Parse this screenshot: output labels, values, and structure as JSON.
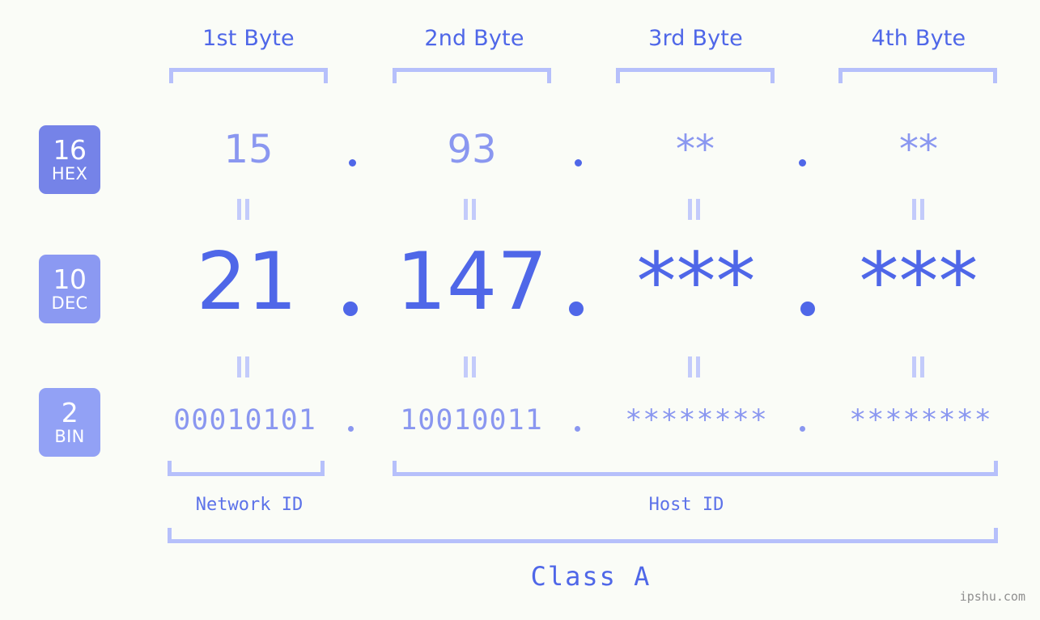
{
  "page": {
    "background_color": "#fafcf7",
    "accent_strong": "#4f67e8",
    "accent_mid": "#8a97f0",
    "accent_light": "#b6c0fb",
    "watermark": "ipshu.com"
  },
  "byte_headers": [
    {
      "label": "1st Byte"
    },
    {
      "label": "2nd Byte"
    },
    {
      "label": "3rd Byte"
    },
    {
      "label": "4th Byte"
    }
  ],
  "bases": [
    {
      "num": "16",
      "abbr": "HEX",
      "badge_color": "#7583e8"
    },
    {
      "num": "10",
      "abbr": "DEC",
      "badge_color": "#8b99f2"
    },
    {
      "num": "2",
      "abbr": "BIN",
      "badge_color": "#92a1f5"
    }
  ],
  "rows": {
    "hex": {
      "base": "16",
      "name": "HEX",
      "values": [
        "15",
        "93",
        "**",
        "**"
      ],
      "separator": "."
    },
    "dec": {
      "base": "10",
      "name": "DEC",
      "values": [
        "21",
        "147",
        "***",
        "***"
      ],
      "separator": "."
    },
    "bin": {
      "base": "2",
      "name": "BIN",
      "values": [
        "00010101",
        "10010011",
        "********",
        "********"
      ],
      "separator": "."
    }
  },
  "equivalence_symbol": "||",
  "segments": {
    "network_id": {
      "label": "Network ID"
    },
    "host_id": {
      "label": "Host ID"
    },
    "class": {
      "label": "Class A"
    }
  }
}
